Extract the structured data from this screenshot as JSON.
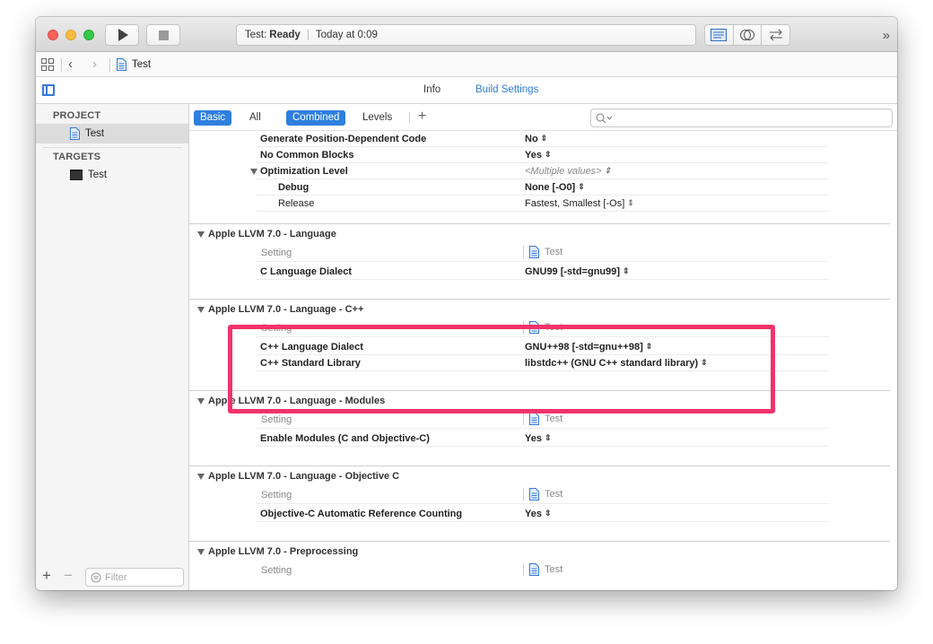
{
  "toolbar": {
    "status_target": "Test:",
    "status_state": "Ready",
    "status_time": "Today at 0:09"
  },
  "jumpbar": {
    "file": "Test"
  },
  "tabs": {
    "info": "Info",
    "build_settings": "Build Settings"
  },
  "sidebar": {
    "project_header": "PROJECT",
    "project_item": "Test",
    "targets_header": "TARGETS",
    "target_item": "Test",
    "filter_placeholder": "Filter"
  },
  "filters": {
    "basic": "Basic",
    "all": "All",
    "combined": "Combined",
    "levels": "Levels"
  },
  "top_rows": [
    {
      "name": "Generate Position-Dependent Code",
      "value": "No"
    },
    {
      "name": "No Common Blocks",
      "value": "Yes"
    },
    {
      "name": "Optimization Level",
      "value": "<Multiple values>"
    },
    {
      "name": "Debug",
      "value": "None [-O0]"
    },
    {
      "name": "Release",
      "value": "Fastest, Smallest [-Os]"
    }
  ],
  "col_setting": "Setting",
  "col_target": "Test",
  "sections": [
    {
      "title": "Apple LLVM 7.0 - Language",
      "rows": [
        {
          "name": "C Language Dialect",
          "value": "GNU99 [-std=gnu99]"
        }
      ]
    },
    {
      "title": "Apple LLVM 7.0 - Language - C++",
      "rows": [
        {
          "name": "C++ Language Dialect",
          "value": "GNU++98 [-std=gnu++98]"
        },
        {
          "name": "C++ Standard Library",
          "value": "libstdc++ (GNU C++ standard library)"
        }
      ]
    },
    {
      "title": "Apple LLVM 7.0 - Language - Modules",
      "rows": [
        {
          "name": "Enable Modules (C and Objective-C)",
          "value": "Yes"
        }
      ]
    },
    {
      "title": "Apple LLVM 7.0 - Language - Objective C",
      "rows": [
        {
          "name": "Objective-C Automatic Reference Counting",
          "value": "Yes"
        }
      ]
    },
    {
      "title": "Apple LLVM 7.0 - Preprocessing",
      "rows": []
    }
  ],
  "colors": {
    "accent": "#2e7fde",
    "highlight": "#f2336b"
  }
}
